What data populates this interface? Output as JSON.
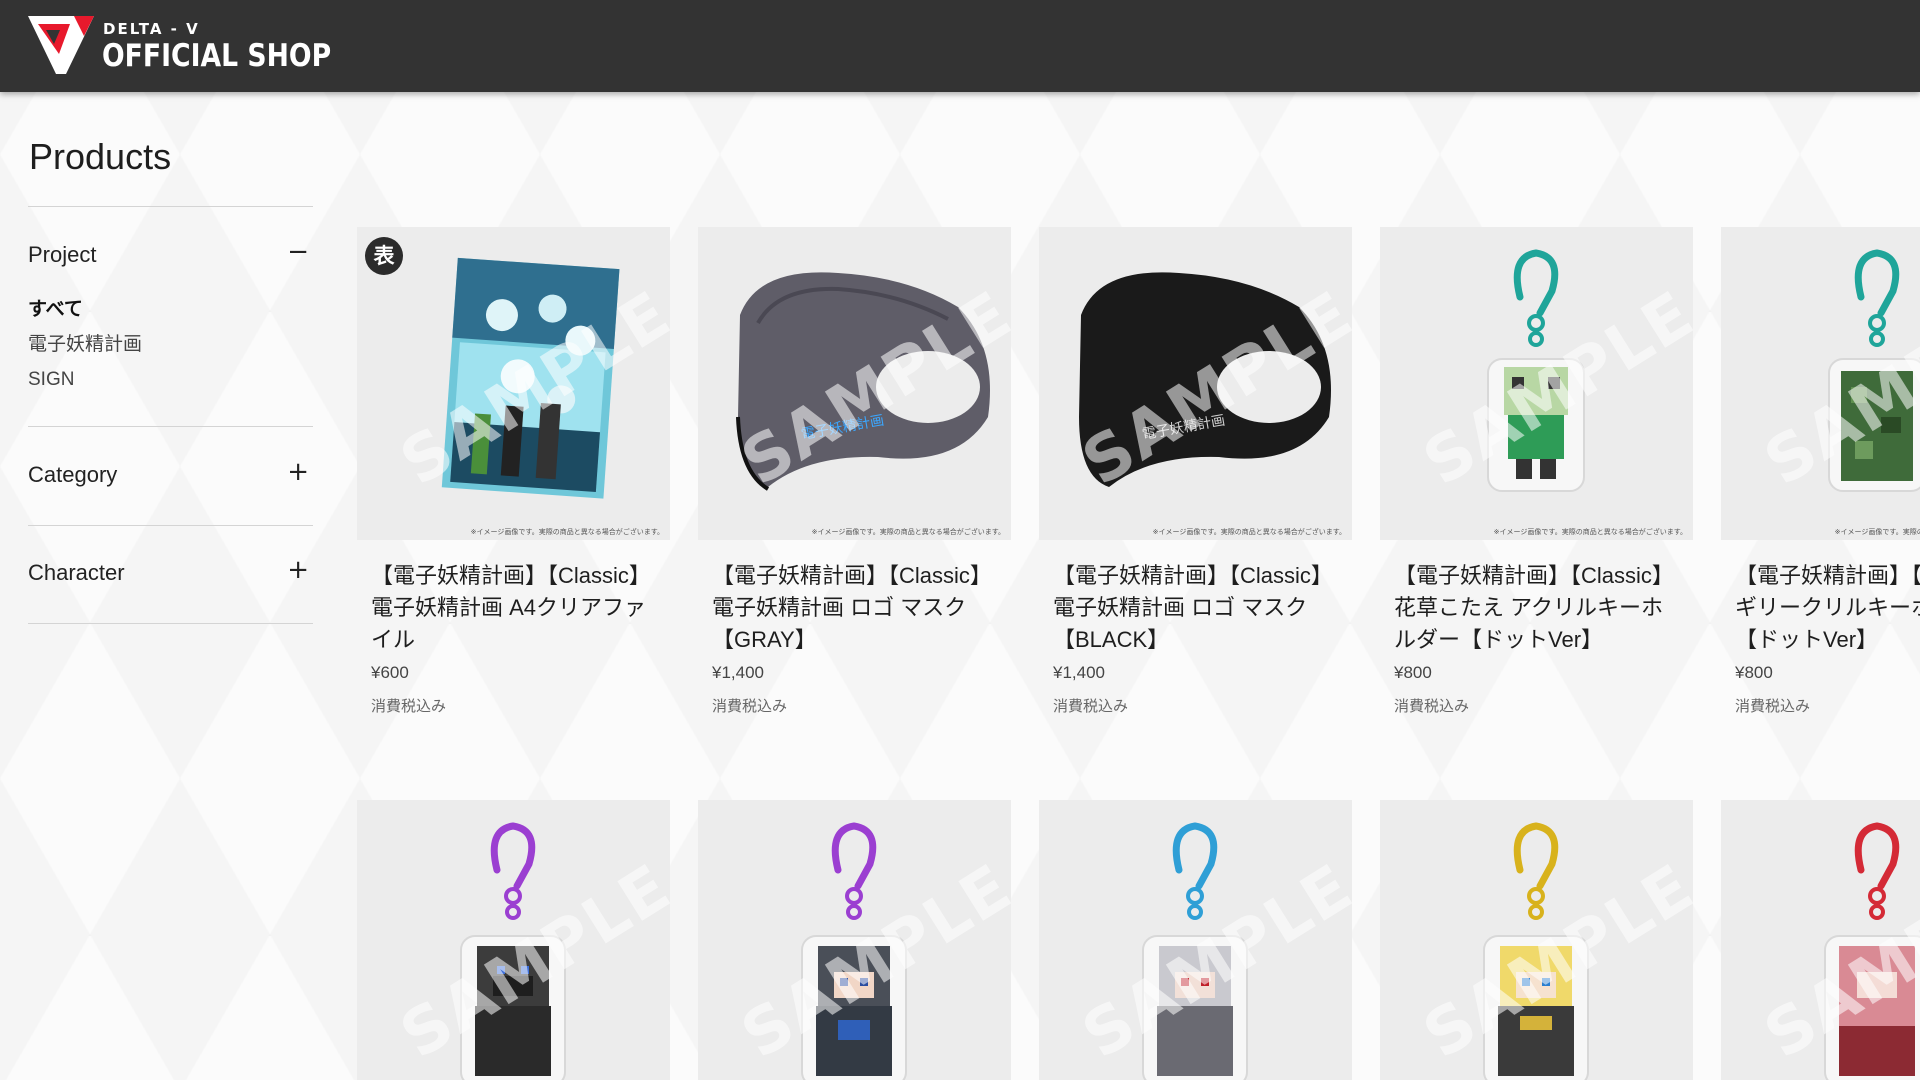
{
  "header": {
    "logo_sub": "DELTA - V",
    "logo_main": "OFFICIAL SHOP"
  },
  "sidebar": {
    "title": "Products",
    "filters": [
      {
        "label": "Project",
        "toggle": "−",
        "options": [
          "すべて",
          "電子妖精計画",
          "SIGN"
        ],
        "active_option": "すべて"
      },
      {
        "label": "Category",
        "toggle": "+"
      },
      {
        "label": "Character",
        "toggle": "+"
      }
    ]
  },
  "watermark": "SAMPLE",
  "disclaimer": "※イメージ画像です。実際の商品と異なる場合がございます。",
  "badge": "表",
  "products": [
    {
      "name": "【電子妖精計画】【Classic】電子妖精計画 A4クリアファイル",
      "price": "¥600",
      "tax": "消費税込み",
      "image": "clear-file"
    },
    {
      "name": "【電子妖精計画】【Classic】電子妖精計画 ロゴ マスク 【GRAY】",
      "price": "¥1,400",
      "tax": "消費税込み",
      "image": "mask-gray",
      "mask_text": "電子妖精計画"
    },
    {
      "name": "【電子妖精計画】【Classic】電子妖精計画 ロゴ マスク 【BLACK】",
      "price": "¥1,400",
      "tax": "消費税込み",
      "image": "mask-black",
      "mask_text": "電子妖精計画"
    },
    {
      "name": "【電子妖精計画】【Classic】花草こたえ アクリルキーホルダー【ドットVer】",
      "price": "¥800",
      "tax": "消費税込み",
      "image": "keyholder",
      "clip_color": "#1fa59a"
    },
    {
      "name": "【電子妖精計画】【Classic】ギリークリルキーホルダー【ドットVer】",
      "price": "¥800",
      "tax": "消費税込み",
      "image": "keyholder",
      "clip_color": "#1fa59a"
    }
  ],
  "products_row2": [
    {
      "image": "keyholder",
      "clip_color": "#9b3fd1"
    },
    {
      "image": "keyholder",
      "clip_color": "#9b3fd1"
    },
    {
      "image": "keyholder",
      "clip_color": "#2f9fd6"
    },
    {
      "image": "keyholder",
      "clip_color": "#d8b21c"
    },
    {
      "image": "keyholder",
      "clip_color": "#d42a36"
    }
  ],
  "colors": {
    "header_bg": "#333333",
    "logo_red": "#e8192c",
    "thumb_bg": "#ececec"
  }
}
